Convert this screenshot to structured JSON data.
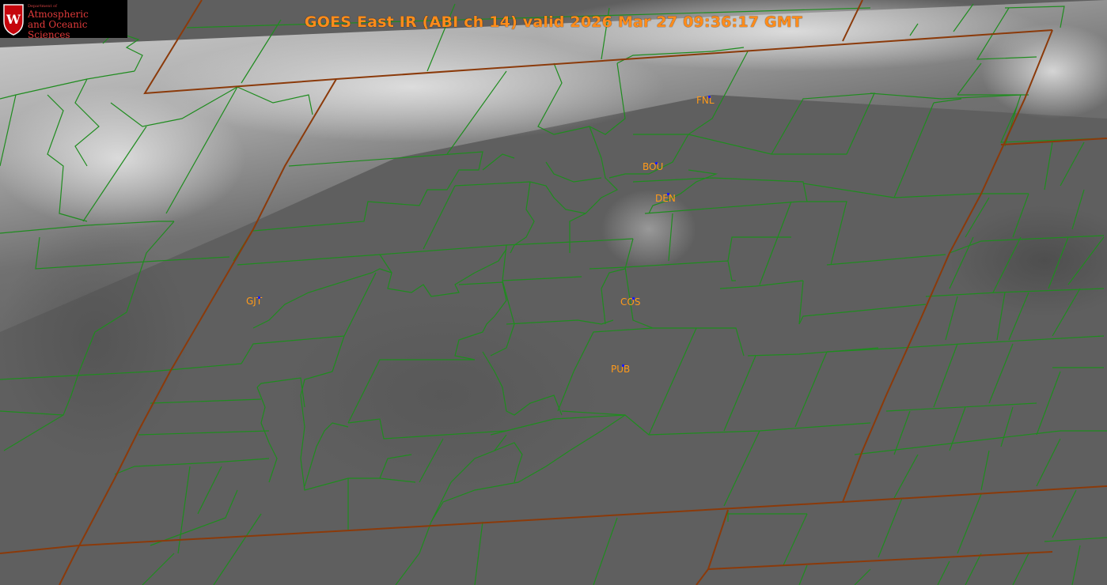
{
  "title": "GOES East IR (ABI ch 14) valid 2026 Mar 27 09:36:17 GMT",
  "logo": {
    "department": "Department of",
    "line1": "Atmospheric",
    "line2": "and Oceanic Sciences",
    "crest_letter": "W"
  },
  "stations": [
    {
      "code": "FNL"
    },
    {
      "code": "BOU"
    },
    {
      "code": "DEN"
    },
    {
      "code": "GJT"
    },
    {
      "code": "COS"
    },
    {
      "code": "PUB"
    }
  ],
  "colors": {
    "county_lines": "#1f8c1f",
    "state_lines": "#8b3a0a",
    "station_labels": "#ff9a1a",
    "title": "#ff8c1a",
    "logo_red": "#e03a3a"
  }
}
